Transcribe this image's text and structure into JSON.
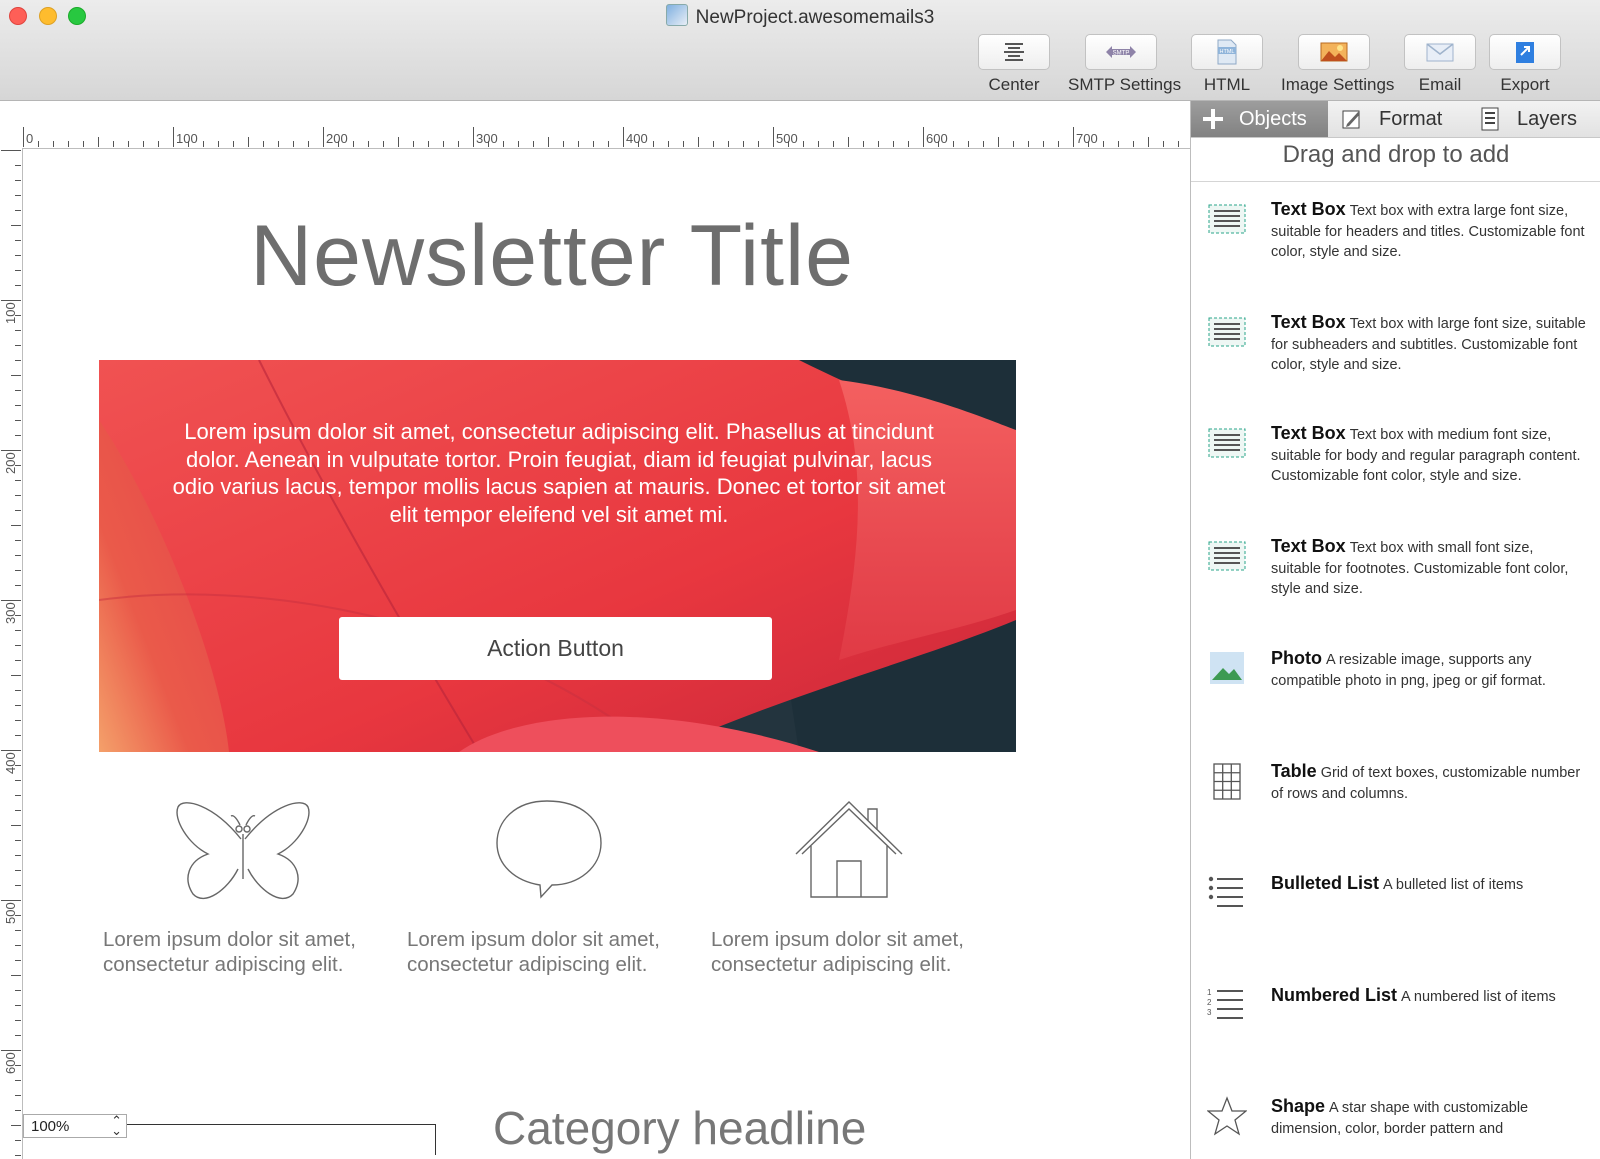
{
  "window": {
    "title": "NewProject.awesomemails3"
  },
  "toolbar": [
    {
      "label": "Center",
      "icon": "center-align-icon"
    },
    {
      "label": "SMTP Settings",
      "icon": "smtp-icon",
      "badge": "SMTP"
    },
    {
      "label": "HTML",
      "icon": "html-file-icon",
      "badge": "HTML"
    },
    {
      "label": "Image Settings",
      "icon": "image-settings-icon"
    },
    {
      "label": "Email",
      "icon": "envelope-icon"
    },
    {
      "label": "Export",
      "icon": "export-icon"
    }
  ],
  "ruler": {
    "horizontal": [
      "0",
      "100",
      "200",
      "300",
      "400",
      "500",
      "600",
      "700"
    ],
    "vertical": [
      "100",
      "200",
      "300",
      "400",
      "500",
      "600"
    ]
  },
  "canvas": {
    "newsletter_title": "Newsletter Title",
    "hero_text": "Lorem ipsum dolor sit amet, consectetur adipiscing elit. Phasellus at tincidunt dolor. Aenean in vulputate tortor. Proin feugiat, diam id feugiat pulvinar, lacus odio varius lacus, tempor mollis lacus sapien at mauris. Donec et tortor sit amet elit tempor eleifend vel sit amet mi.",
    "action_button": "Action Button",
    "features": [
      {
        "icon": "butterfly-icon",
        "text": "Lorem ipsum dolor sit amet, consectetur adipiscing elit."
      },
      {
        "icon": "speech-bubble-icon",
        "text": "Lorem ipsum dolor sit amet, consectetur adipiscing elit."
      },
      {
        "icon": "house-icon",
        "text": "Lorem ipsum dolor sit amet, consectetur adipiscing elit."
      }
    ],
    "category_headline": "Category headline",
    "zoom": "100%"
  },
  "panel": {
    "tabs": [
      {
        "label": "Objects",
        "icon": "plus-icon",
        "active": true
      },
      {
        "label": "Format",
        "icon": "pencil-icon",
        "active": false
      },
      {
        "label": "Layers",
        "icon": "layers-icon",
        "active": false
      }
    ],
    "hint": "Drag and drop to add",
    "objects": [
      {
        "name": "Text Box",
        "icon": "text-box-icon",
        "description": "Text box with extra large font size, suitable for headers and titles. Customizable font color, style and size."
      },
      {
        "name": "Text Box",
        "icon": "text-box-icon",
        "description": "Text box with large font size, suitable for subheaders and subtitles. Customizable font color, style and size."
      },
      {
        "name": "Text Box",
        "icon": "text-box-icon",
        "description": "Text box with medium font size, suitable for body and regular paragraph content. Customizable font color, style and size."
      },
      {
        "name": "Text Box",
        "icon": "text-box-icon",
        "description": "Text box with small font size, suitable for footnotes. Customizable font color, style and size."
      },
      {
        "name": "Photo",
        "icon": "photo-icon",
        "description": "A resizable image, supports any compatible photo in png, jpeg or gif format."
      },
      {
        "name": "Table",
        "icon": "table-grid-icon",
        "description": "Grid of text boxes, customizable number of rows and columns."
      },
      {
        "name": "Bulleted List",
        "icon": "bulleted-list-icon",
        "description": "A bulleted list of items"
      },
      {
        "name": "Numbered List",
        "icon": "numbered-list-icon",
        "description": "A numbered list of items"
      },
      {
        "name": "Shape",
        "icon": "star-shape-icon",
        "description": "A star shape with customizable dimension, color, border pattern and"
      }
    ]
  },
  "colors": {
    "traffic_close": "#fe5f57",
    "traffic_minimize": "#febc2e",
    "traffic_zoom": "#28c840",
    "active_tab": "#8f8f8f",
    "text_box_icon": "#2aa58a"
  }
}
